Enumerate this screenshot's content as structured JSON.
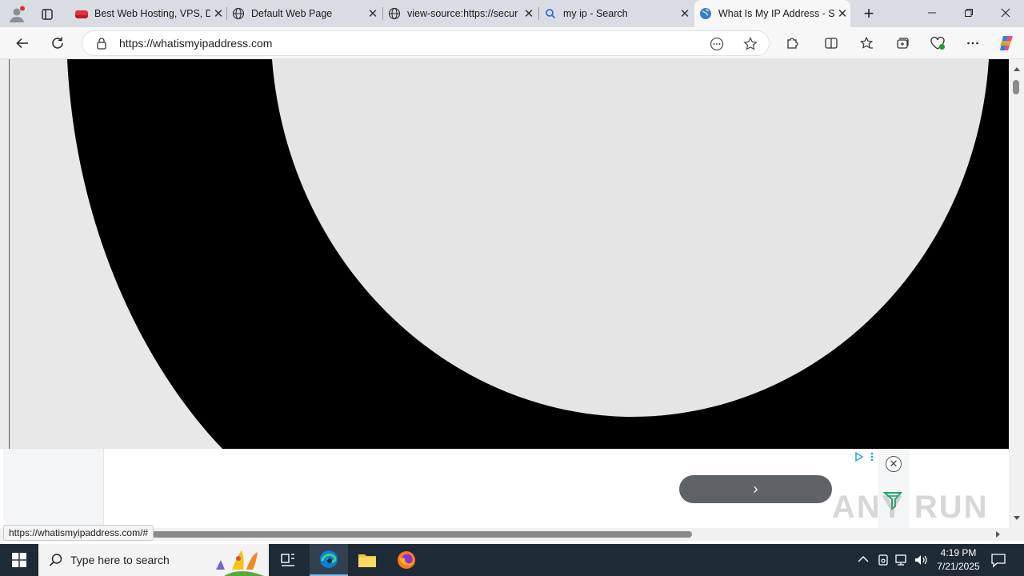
{
  "browser": {
    "tabs": [
      {
        "label": "Best Web Hosting, VPS, D",
        "active": false
      },
      {
        "label": "Default Web Page",
        "active": false
      },
      {
        "label": "view-source:https://secur",
        "active": false
      },
      {
        "label": "my ip - Search",
        "active": false
      },
      {
        "label": "What Is My IP Address - S",
        "active": true
      }
    ],
    "new_tab_symbol": "+",
    "close_symbol": "✕",
    "address": "https://whatismyipaddress.com",
    "status_url": "https://whatismyipaddress.com/#"
  },
  "ad": {
    "cta_symbol": "›"
  },
  "watermark": "ANY RUN",
  "taskbar": {
    "search_placeholder": "Type here to search",
    "time": "4:19 PM",
    "date": "7/21/2025"
  },
  "colors": {
    "tabstrip": "#d9dde3",
    "toolbar": "#f7f7f7",
    "hero_ring": "#000000",
    "hero_fill": "#e5e5e5",
    "taskbar": "#1f2a37",
    "edge_accent": "#0c7dd8"
  }
}
